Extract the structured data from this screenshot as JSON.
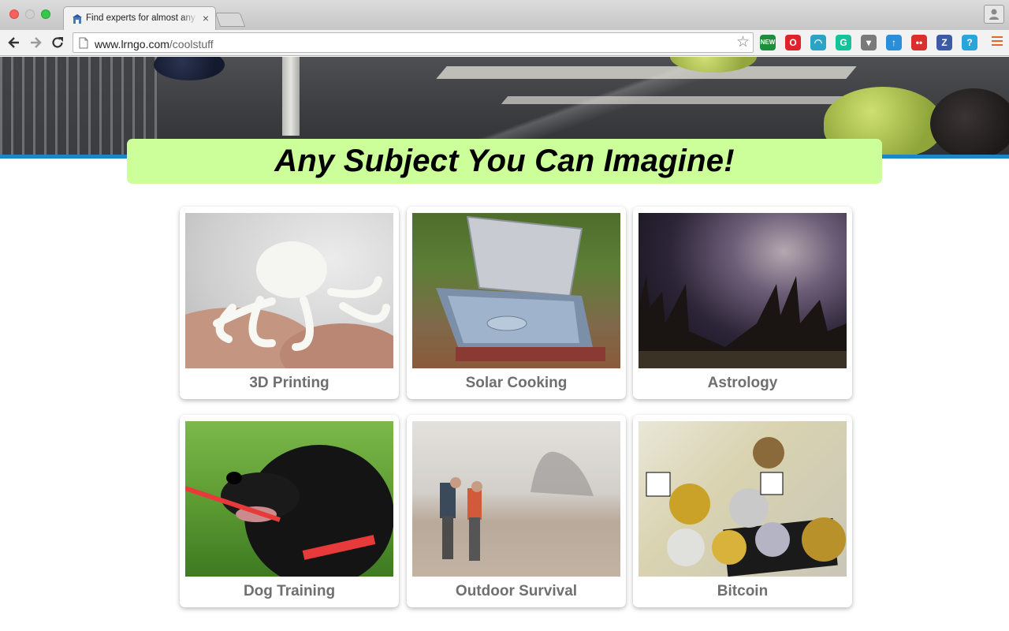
{
  "browser": {
    "tab_title": "Find experts for almost any subject",
    "tab_close": "×",
    "url_host": "www.lrngo.com",
    "url_path": "/coolstuff",
    "extensions": [
      {
        "name": "new-extension-icon",
        "label": "NEW",
        "color": "#1c8f3c"
      },
      {
        "name": "opera-extension-icon",
        "label": "O",
        "color": "#e0232a"
      },
      {
        "name": "wave-extension-icon",
        "label": "◠",
        "color": "#2aa3c6"
      },
      {
        "name": "grammarly-extension-icon",
        "label": "G",
        "color": "#15c39a"
      },
      {
        "name": "pocket-extension-icon",
        "label": "▾",
        "color": "#7a7a7a"
      },
      {
        "name": "bookmark-extension-icon",
        "label": "↑",
        "color": "#2a8fd8"
      },
      {
        "name": "signal-extension-icon",
        "label": "••",
        "color": "#d9302e"
      },
      {
        "name": "z-extension-icon",
        "label": "Z",
        "color": "#3b5ba5"
      },
      {
        "name": "help-extension-icon",
        "label": "?",
        "color": "#28a6d9"
      }
    ]
  },
  "page": {
    "headline": "Any Subject You Can Imagine!",
    "subjects": [
      {
        "label": "3D Printing",
        "photo": "3d-printed-octopus-photo"
      },
      {
        "label": "Solar Cooking",
        "photo": "solar-oven-photo"
      },
      {
        "label": "Astrology",
        "photo": "milky-way-sky-photo"
      },
      {
        "label": "Dog Training",
        "photo": "black-dog-photo"
      },
      {
        "label": "Outdoor Survival",
        "photo": "hikers-foggy-beach-photo"
      },
      {
        "label": "Bitcoin",
        "photo": "bitcoin-coins-photo"
      }
    ]
  },
  "colors": {
    "banner": "#ccff99",
    "accent_bar": "#1b87c9",
    "card_label": "#6f6f6f"
  }
}
